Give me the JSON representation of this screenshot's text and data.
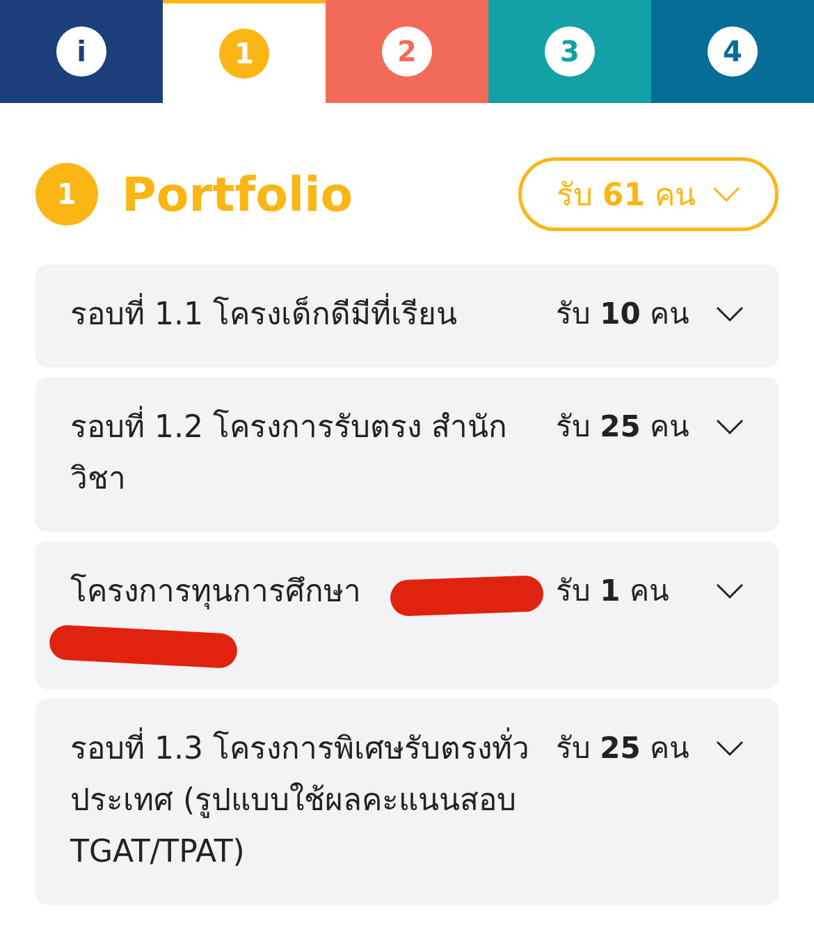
{
  "tabs": [
    {
      "label": "i",
      "selected": false,
      "color": "#1b3f7a"
    },
    {
      "label": "1",
      "selected": true,
      "color": "#fbb615"
    },
    {
      "label": "2",
      "selected": false,
      "color": "#f26a58"
    },
    {
      "label": "3",
      "selected": false,
      "color": "#13a0a6"
    },
    {
      "label": "4",
      "selected": false,
      "color": "#066c98"
    }
  ],
  "header": {
    "number": "1",
    "title": "Portfolio",
    "quota_button": "รับ **61** คน"
  },
  "rounds": [
    {
      "title": "รอบที่ 1.1 โครงเด็กดีมีที่เรียน",
      "quota": "รับ **10** คน",
      "redacted": false
    },
    {
      "title": "รอบที่ 1.2 โครงการรับตรง สำนักวิชา",
      "quota": "รับ **25** คน",
      "redacted": false
    },
    {
      "title": "โครงการทุนการศึกษา",
      "quota": "รับ **1** คน",
      "redacted": true
    },
    {
      "title": "รอบที่ 1.3 โครงการพิเศษรับตรงทั่วประเทศ (รูปแบบใช้ผลคะแนนสอบ TGAT/TPAT)",
      "quota": "รับ **25** คน",
      "redacted": false
    }
  ]
}
